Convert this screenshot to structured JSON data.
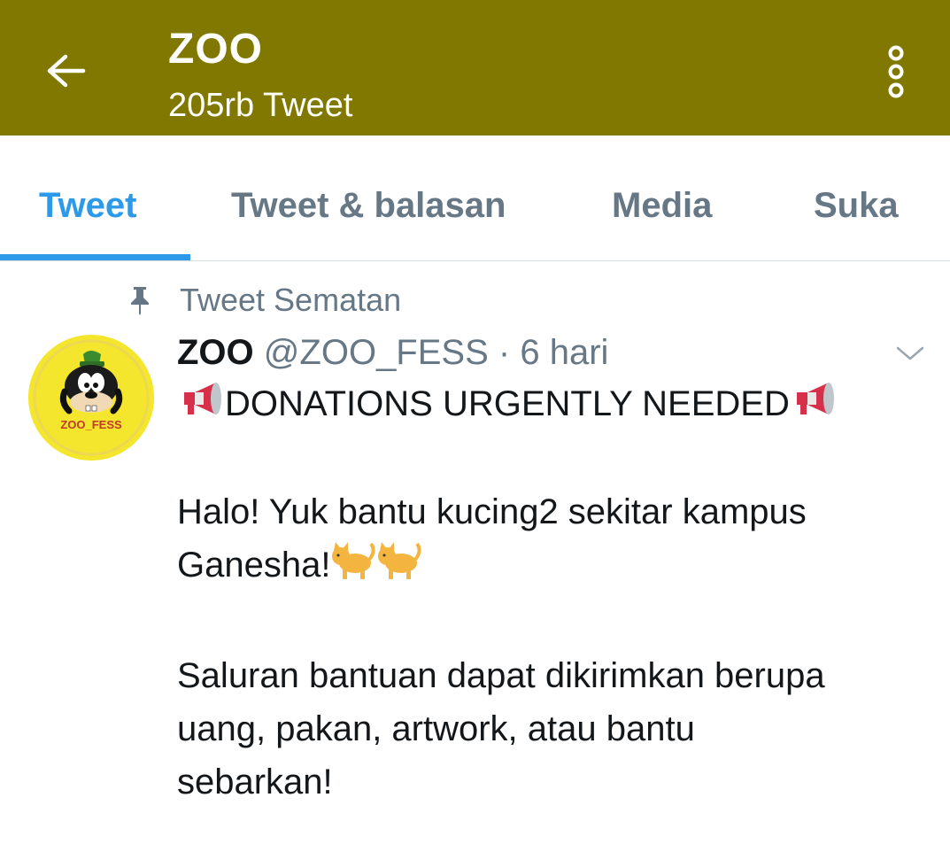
{
  "header": {
    "title": "ZOO",
    "subtitle": "205rb Tweet",
    "back_icon": "arrow-left-icon",
    "more_icon": "more-vertical-icon",
    "bg_color": "#807800"
  },
  "tabs": [
    {
      "label": "Tweet",
      "active": true
    },
    {
      "label": "Tweet & balasan",
      "active": false
    },
    {
      "label": "Media",
      "active": false
    },
    {
      "label": "Suka",
      "active": false
    }
  ],
  "accent_color": "#2c9ae8",
  "pinned": {
    "label": "Tweet Sematan",
    "icon": "pin-icon"
  },
  "tweet": {
    "avatar_text": "ZOO_FESS",
    "display_name": "ZOO",
    "handle": "@ZOO_FESS",
    "separator": "·",
    "time": "6 hari",
    "headline": "DONATIONS URGENTLY NEEDED",
    "paragraph1_line1": "Halo! Yuk bantu kucing2 sekitar kampus",
    "paragraph1_line2": "Ganesha!",
    "paragraph2_line1": "Saluran bantuan dapat dikirimkan berupa",
    "paragraph2_line2": "uang, pakan, artwork, atau bantu",
    "paragraph2_line3": "sebarkan!"
  }
}
